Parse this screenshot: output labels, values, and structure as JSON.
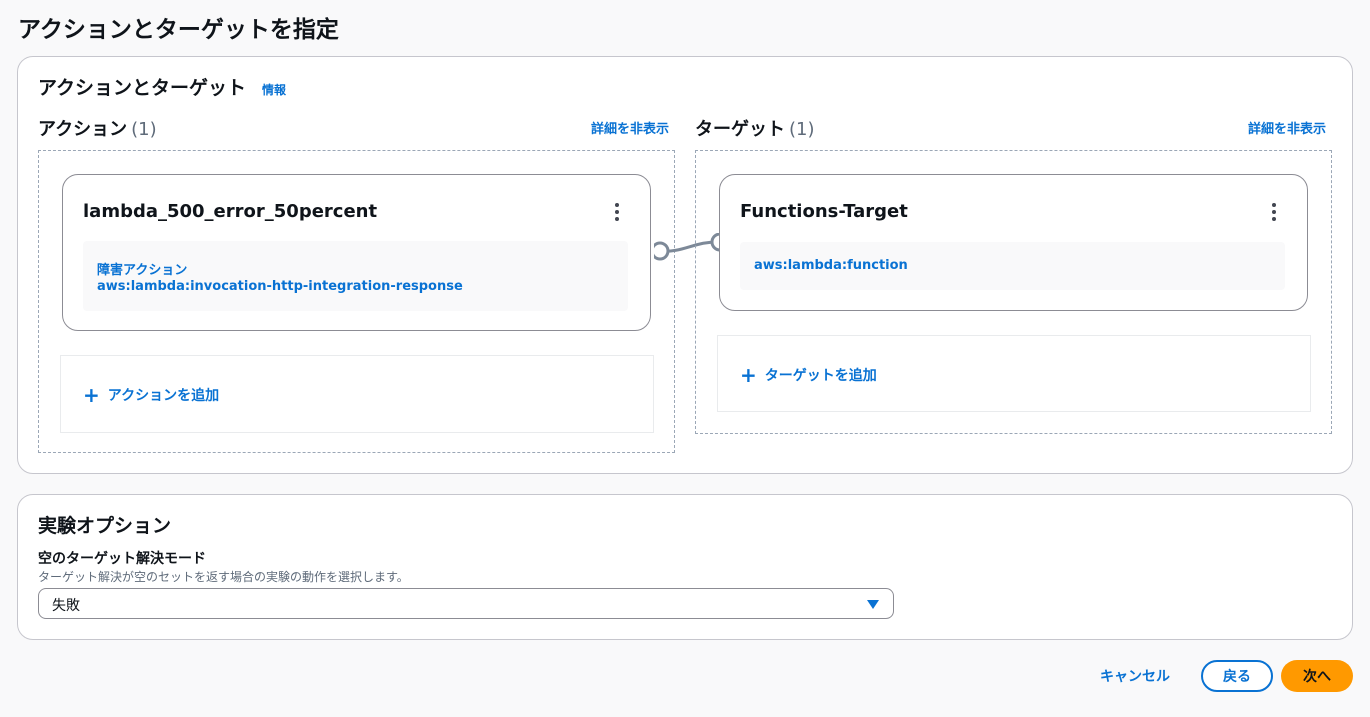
{
  "page": {
    "title": "アクションとターゲットを指定"
  },
  "actions_panel": {
    "heading": "アクションとターゲット",
    "info_link": "情報",
    "actions_column": {
      "heading": "アクション",
      "count": "(1)",
      "toggle_link": "詳細を非表示",
      "card": {
        "title": "lambda_500_error_50percent",
        "type_label": "障害アクション",
        "action_id": "aws:lambda:invocation-http-integration-response"
      },
      "add_label": "アクションを追加"
    },
    "targets_column": {
      "heading": "ターゲット",
      "count": "(1)",
      "toggle_link": "詳細を非表示",
      "card": {
        "title": "Functions-Target",
        "resource_type": "aws:lambda:function"
      },
      "add_label": "ターゲットを追加"
    }
  },
  "options_panel": {
    "heading": "実験オプション",
    "field_label": "空のターゲット解決モード",
    "field_description": "ターゲット解決が空のセットを返す場合の実験の動作を選択します。",
    "selected_value": "失敗"
  },
  "footer": {
    "cancel_label": "キャンセル",
    "back_label": "戻る",
    "next_label": "次へ"
  },
  "colors": {
    "link": "#0972d3",
    "primary": "#ff9900"
  },
  "icons": [
    "kebab-menu-icon",
    "plus-icon",
    "caret-down-icon",
    "connector-icon"
  ]
}
